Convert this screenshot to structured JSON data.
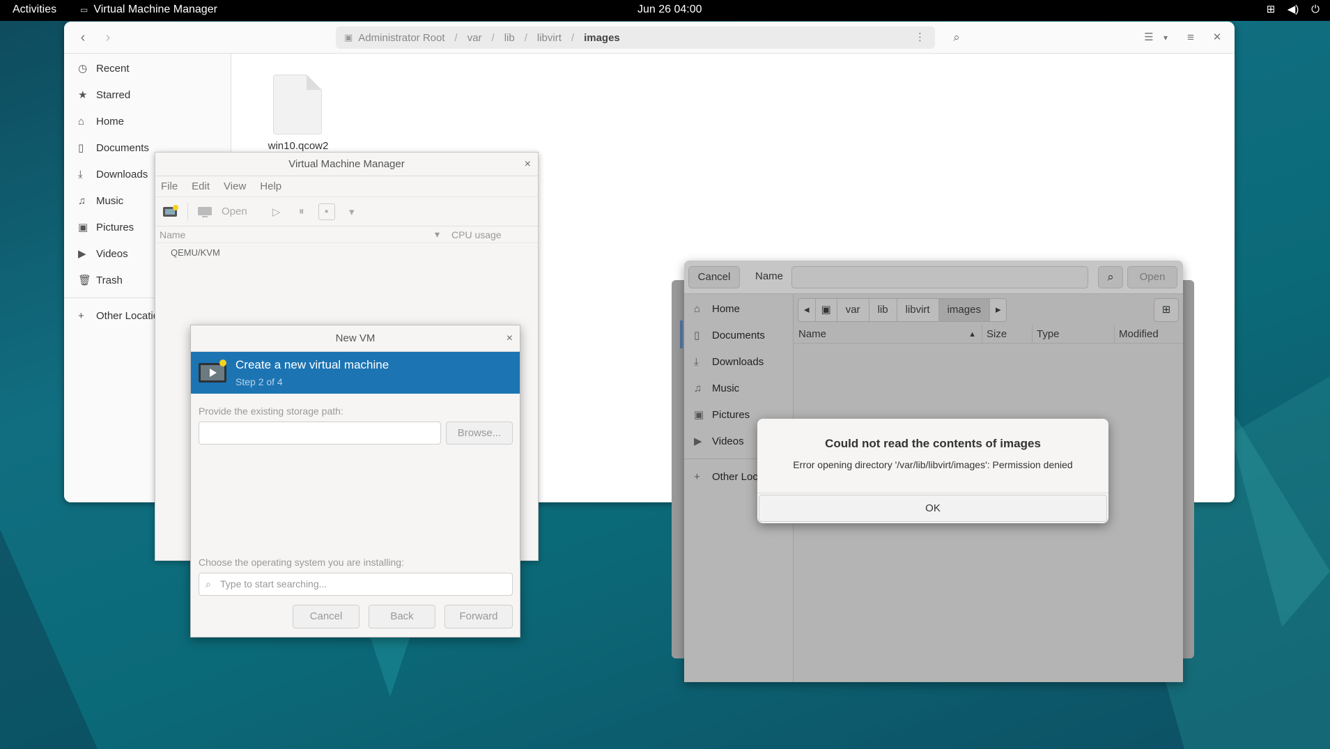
{
  "topbar": {
    "activities": "Activities",
    "app_name": "Virtual Machine Manager",
    "clock": "Jun 26  04:00"
  },
  "files": {
    "path": [
      "Administrator Root",
      "var",
      "lib",
      "libvirt",
      "images"
    ],
    "sidebar": [
      {
        "icon": "clock-icon",
        "label": "Recent"
      },
      {
        "icon": "star-icon",
        "label": "Starred"
      },
      {
        "icon": "home-icon",
        "label": "Home"
      },
      {
        "icon": "document-icon",
        "label": "Documents"
      },
      {
        "icon": "download-icon",
        "label": "Downloads"
      },
      {
        "icon": "music-icon",
        "label": "Music"
      },
      {
        "icon": "picture-icon",
        "label": "Pictures"
      },
      {
        "icon": "video-icon",
        "label": "Videos"
      },
      {
        "icon": "trash-icon",
        "label": "Trash"
      }
    ],
    "other_locations": "Other Locatio",
    "file_name": "win10.qcow2"
  },
  "vmm": {
    "title": "Virtual Machine Manager",
    "menu": [
      "File",
      "Edit",
      "View",
      "Help"
    ],
    "open_label": "Open",
    "col_name": "Name",
    "col_cpu": "CPU usage",
    "connection": "QEMU/KVM"
  },
  "newvm": {
    "title": "New VM",
    "banner_title": "Create a new virtual machine",
    "banner_step": "Step 2 of 4",
    "storage_label": "Provide the existing storage path:",
    "storage_value": "",
    "browse": "Browse...",
    "os_label": "Choose the operating system you are installing:",
    "os_placeholder": "Type to start searching...",
    "cancel": "Cancel",
    "back": "Back",
    "forward": "Forward"
  },
  "chooser": {
    "cancel": "Cancel",
    "name_label": "Name",
    "open": "Open",
    "sidebar": [
      {
        "icon": "home-icon",
        "label": "Home"
      },
      {
        "icon": "document-icon",
        "label": "Documents"
      },
      {
        "icon": "download-icon",
        "label": "Downloads"
      },
      {
        "icon": "music-icon",
        "label": "Music"
      },
      {
        "icon": "picture-icon",
        "label": "Pictures"
      },
      {
        "icon": "video-icon",
        "label": "Videos"
      }
    ],
    "other_locations": "Other Loca",
    "crumbs": [
      "var",
      "lib",
      "libvirt",
      "images"
    ],
    "columns": [
      "Name",
      "Size",
      "Type",
      "Modified"
    ]
  },
  "error": {
    "title": "Could not read the contents of images",
    "message": "Error opening directory '/var/lib/libvirt/images': Permission denied",
    "ok": "OK"
  }
}
